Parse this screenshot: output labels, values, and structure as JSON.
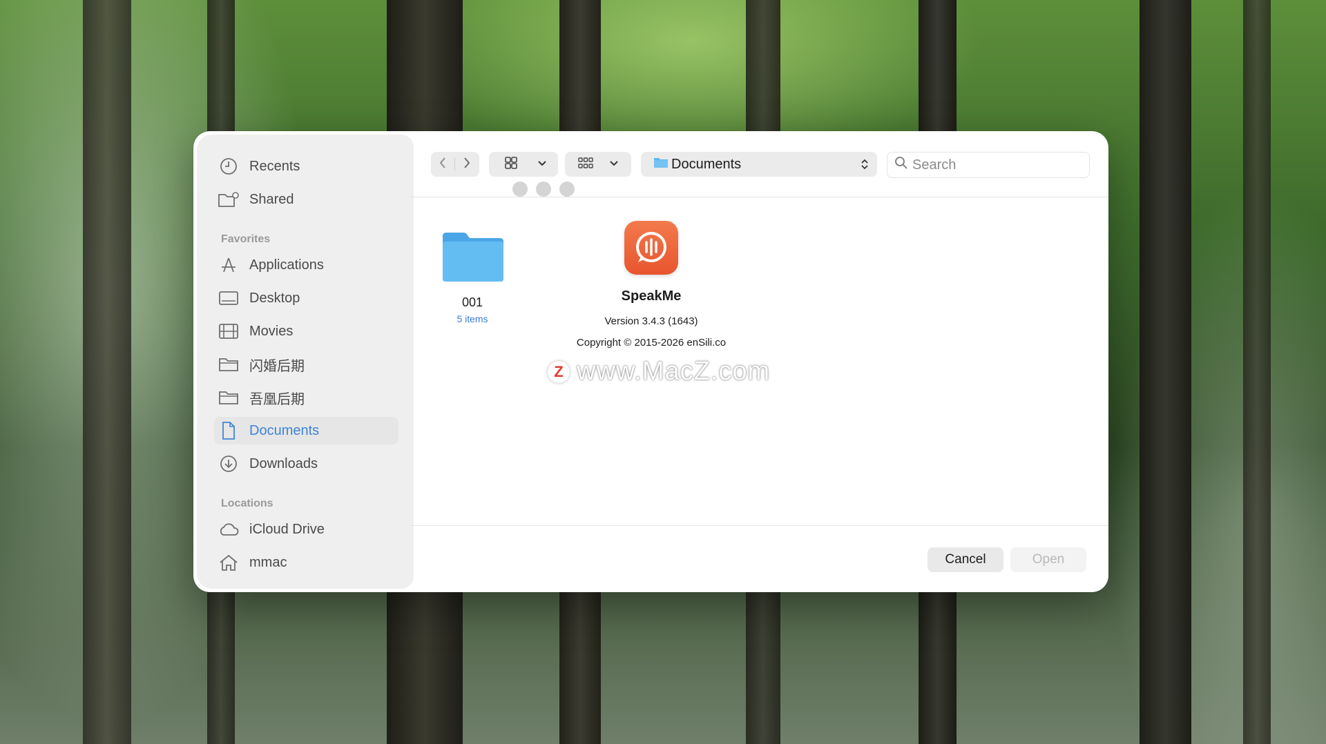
{
  "sidebar": {
    "top_items": [
      {
        "label": "Recents",
        "icon": "clock-icon"
      },
      {
        "label": "Shared",
        "icon": "shared-folder-icon"
      }
    ],
    "favorites_header": "Favorites",
    "favorites": [
      {
        "label": "Applications",
        "icon": "applications-icon"
      },
      {
        "label": "Desktop",
        "icon": "desktop-icon"
      },
      {
        "label": "Movies",
        "icon": "film-icon"
      },
      {
        "label": "闪婚后期",
        "icon": "folder-icon"
      },
      {
        "label": "吾凰后期",
        "icon": "folder-icon"
      },
      {
        "label": "Documents",
        "icon": "document-icon",
        "active": true
      },
      {
        "label": "Downloads",
        "icon": "download-icon"
      }
    ],
    "locations_header": "Locations",
    "locations": [
      {
        "label": "iCloud Drive",
        "icon": "cloud-icon"
      },
      {
        "label": "mmac",
        "icon": "home-icon"
      }
    ]
  },
  "toolbar": {
    "path_label": "Documents",
    "search_placeholder": "Search"
  },
  "files": [
    {
      "name": "001",
      "subtitle": "5 items",
      "icon": "folder-icon"
    }
  ],
  "about": {
    "app_name": "SpeakMe",
    "version": "Version 3.4.3 (1643)",
    "copyright": "Copyright © 2015-2026 enSili.co",
    "icon": "speakme-app-icon"
  },
  "watermark": {
    "logo_letter": "Z",
    "text": "www.MacZ.com"
  },
  "buttons": {
    "cancel": "Cancel",
    "open": "Open"
  },
  "colors": {
    "accent": "#3d84d6",
    "app_icon": "#ed6a3e",
    "folder": "#5bb6ef"
  }
}
